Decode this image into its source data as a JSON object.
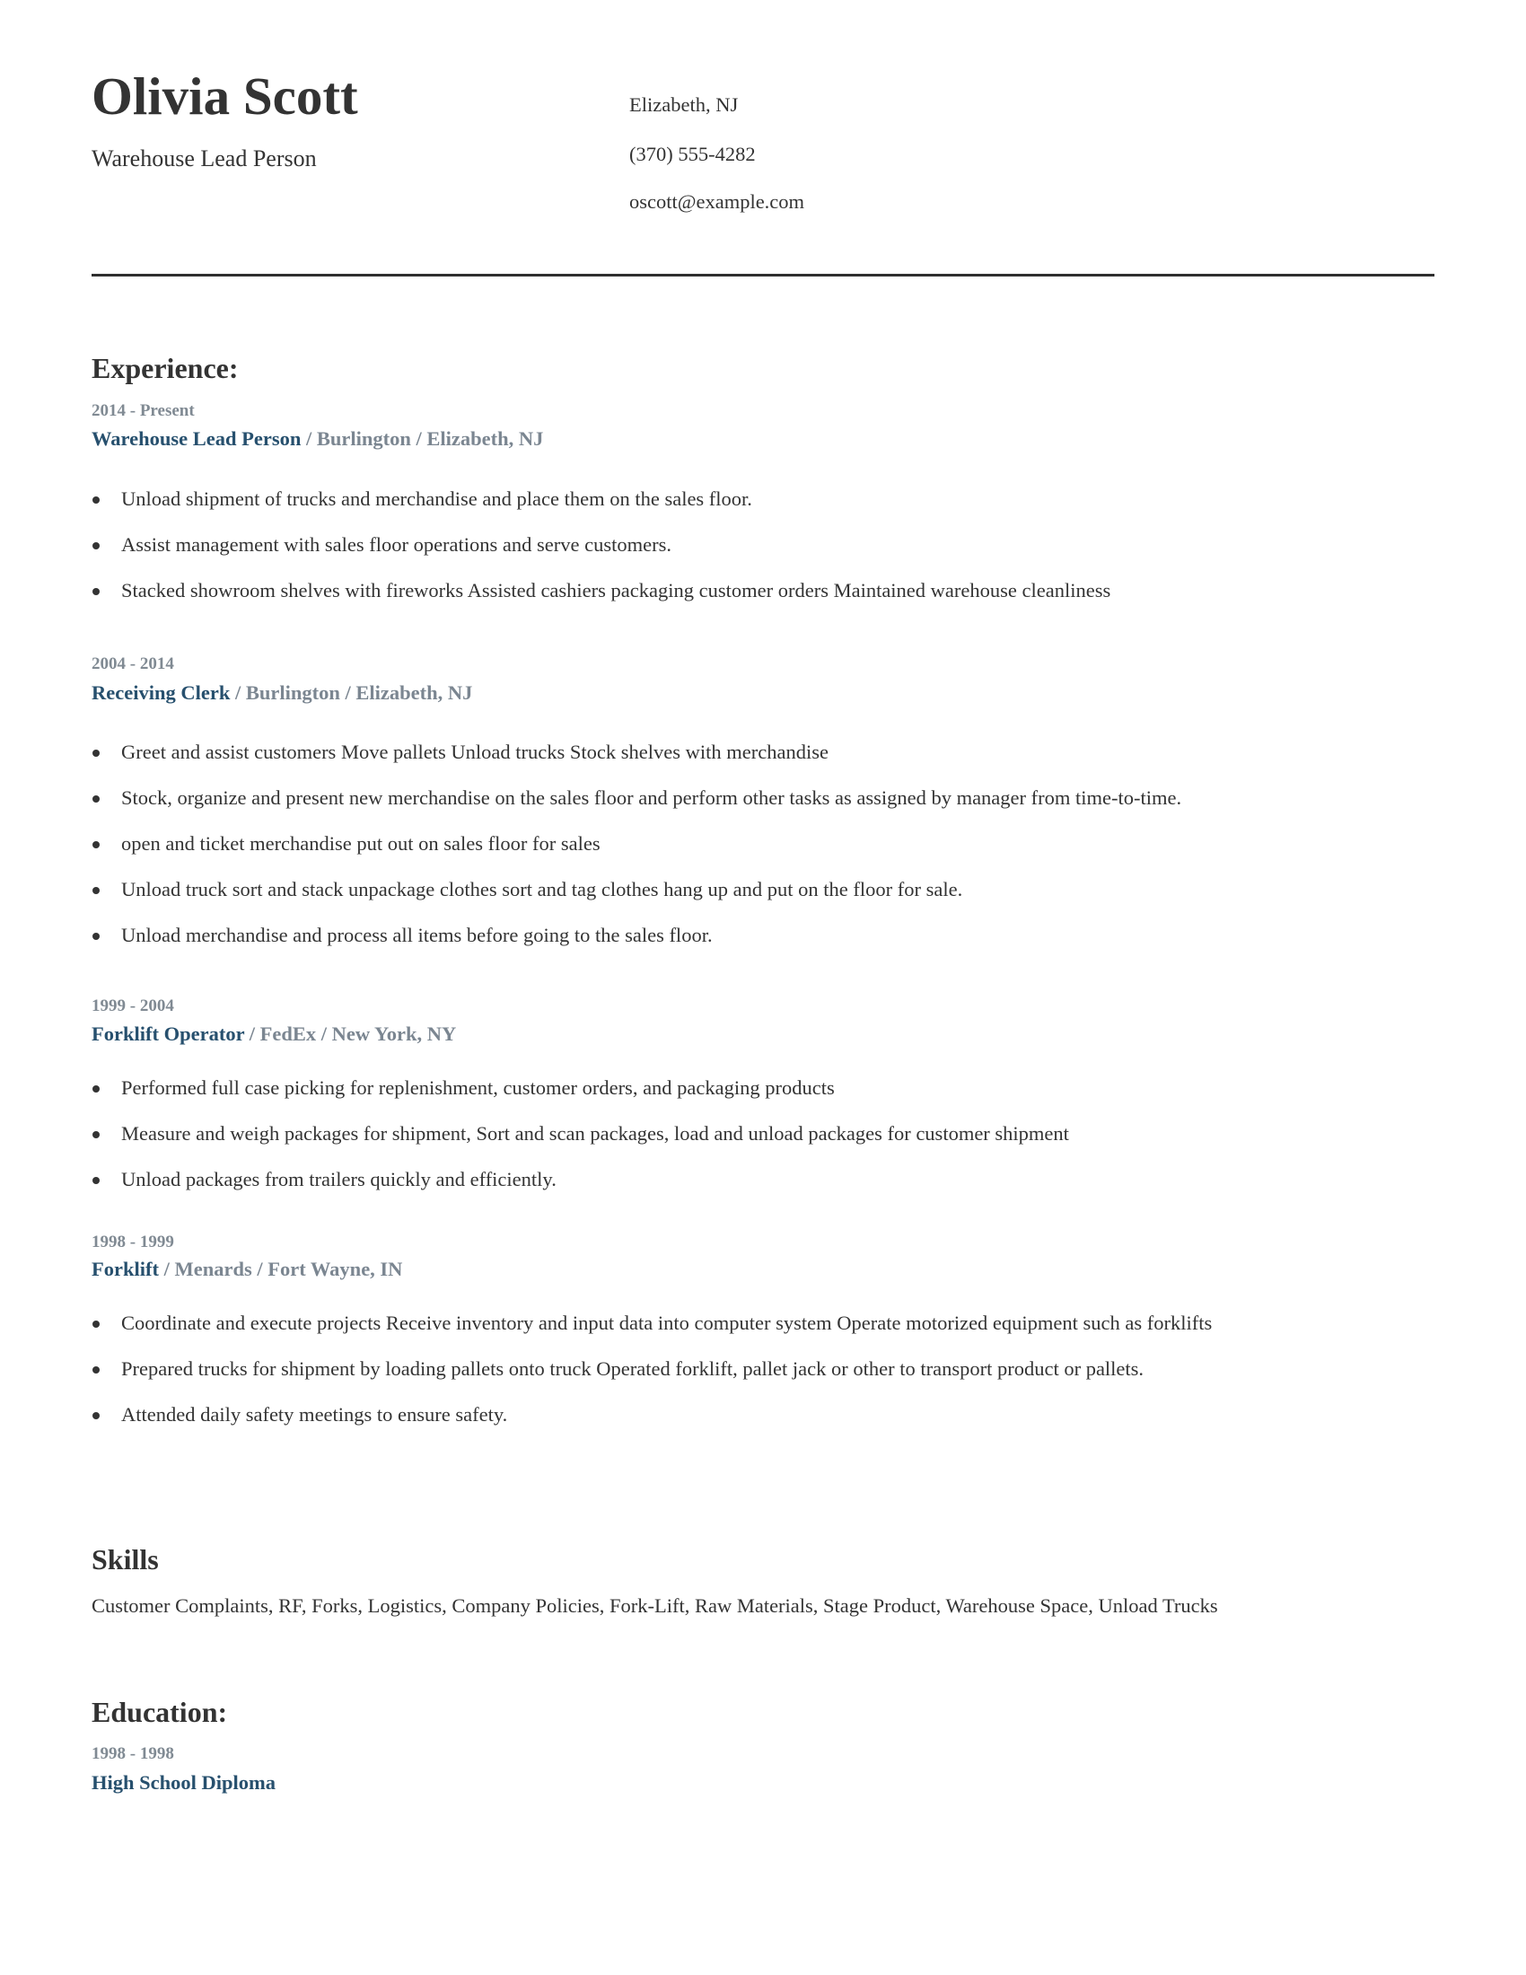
{
  "header": {
    "name": "Olivia Scott",
    "headline": "Warehouse Lead Person",
    "contact": {
      "location": "Elizabeth, NJ",
      "phone": "(370) 555-4282",
      "email": "oscott@example.com"
    }
  },
  "experience": {
    "title": "Experience:",
    "jobs": [
      {
        "dates": "2014 - Present",
        "role": "Warehouse Lead Person",
        "meta": " / Burlington / Elizabeth, NJ",
        "bullets": [
          "Unload shipment of trucks and merchandise and place them on the sales floor.",
          "Assist management with sales floor operations and serve customers.",
          "Stacked showroom shelves with fireworks Assisted cashiers packaging customer orders Maintained warehouse cleanliness"
        ]
      },
      {
        "dates": "2004 - 2014",
        "role": "Receiving Clerk",
        "meta": " / Burlington / Elizabeth, NJ",
        "bullets": [
          "Greet and assist customers Move pallets Unload trucks Stock shelves with merchandise",
          "Stock, organize and present new merchandise on the sales floor and perform other tasks as assigned by manager from time-to-time.",
          "open and ticket merchandise put out on sales floor for sales",
          "Unload truck sort and stack unpackage clothes sort and tag clothes hang up and put on the floor for sale.",
          "Unload merchandise and process all items before going to the sales floor."
        ]
      },
      {
        "dates": "1999 - 2004",
        "role": "Forklift Operator",
        "meta": " / FedEx / New York, NY",
        "bullets": [
          "Performed full case picking for replenishment, customer orders, and packaging products",
          "Measure and weigh packages for shipment, Sort and scan packages, load and unload packages for customer shipment",
          "Unload packages from trailers quickly and efficiently."
        ]
      },
      {
        "dates": "1998 - 1999",
        "role": "Forklift",
        "meta": " / Menards / Fort Wayne, IN",
        "bullets": [
          "Coordinate and execute projects Receive inventory and input data into computer system Operate motorized equipment such as forklifts",
          "Prepared trucks for shipment by loading pallets onto truck Operated forklift, pallet jack or other to transport product or pallets.",
          "Attended daily safety meetings to ensure safety."
        ]
      }
    ]
  },
  "skills": {
    "title": "Skills",
    "text": "Customer Complaints, RF, Forks, Logistics, Company Policies, Fork-Lift, Raw Materials, Stage Product, Warehouse Space, Unload Trucks"
  },
  "education": {
    "title": "Education:",
    "entries": [
      {
        "dates": "1998 - 1998",
        "degree": "High School Diploma"
      }
    ]
  },
  "colors": {
    "text": "#333333",
    "accent_blue": "#27506e",
    "meta_gray": "#7b8691",
    "divider": "#2f2f2f"
  }
}
